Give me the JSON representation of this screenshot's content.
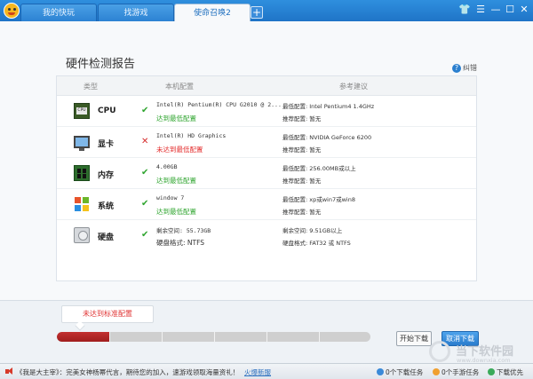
{
  "tabs": [
    {
      "label": "我的快玩"
    },
    {
      "label": "找游戏"
    },
    {
      "label": "使命召唤2"
    }
  ],
  "tab_add": "+",
  "window_controls": {
    "minimize": "—",
    "maximize": "☐",
    "close": "✕"
  },
  "report": {
    "title": "硬件检测报告",
    "help_label": "纠错",
    "columns": {
      "type": "类型",
      "local": "本机配置",
      "suggested": "参考建议"
    }
  },
  "rows": [
    {
      "icon": "cpu-icon",
      "label": "CPU",
      "status": "ok",
      "status_mark": "✔",
      "spec": "Intel(R) Pentium(R) CPU G2010 @ 2...",
      "verdict": "达到最低配置",
      "min": "最低配置: Intel Pentium4 1.4GHz",
      "recommended": "推荐配置: 暂无"
    },
    {
      "icon": "monitor-icon",
      "label": "显卡",
      "status": "bad",
      "status_mark": "✕",
      "spec": "Intel(R) HD Graphics",
      "verdict": "未达到最低配置",
      "min": "最低配置: NVIDIA GeForce 6200",
      "recommended": "推荐配置: 暂无"
    },
    {
      "icon": "memory-icon",
      "label": "内存",
      "status": "ok",
      "status_mark": "✔",
      "spec": "4.00GB",
      "verdict": "达到最低配置",
      "min": "最低配置: 256.00MB或以上",
      "recommended": "推荐配置: 暂无"
    },
    {
      "icon": "windows-icon",
      "label": "系统",
      "status": "ok",
      "status_mark": "✔",
      "spec": "window 7",
      "verdict": "达到最低配置",
      "min": "最低配置: xp或win7或win8",
      "recommended": "推荐配置: 暂无"
    },
    {
      "icon": "disk-icon",
      "label": "硬盘",
      "status": "ok",
      "status_mark": "✔",
      "spec": "剩余空间: 55.73GB",
      "verdict": "硬盘格式: NTFS",
      "min": "剩余空间: 9.51GB以上",
      "recommended": "硬盘格式: FAT32 或 NTFS"
    }
  ],
  "progress": {
    "bubble_text": "未达到标准配置",
    "fraction": 0.17,
    "start_button": "开始下载",
    "cancel_button": "取消下载"
  },
  "statusbar": {
    "news": "《我是大主宰》：完美女神杨幂代言，期待您的加入，速游戏领取海量资礼！",
    "link": "火爆新服",
    "downloads": "0个下载任务",
    "mobile": "0个手游任务",
    "priority": "下载优先"
  },
  "watermark": {
    "text": "当下软件园",
    "url": "www.downxia.com"
  }
}
